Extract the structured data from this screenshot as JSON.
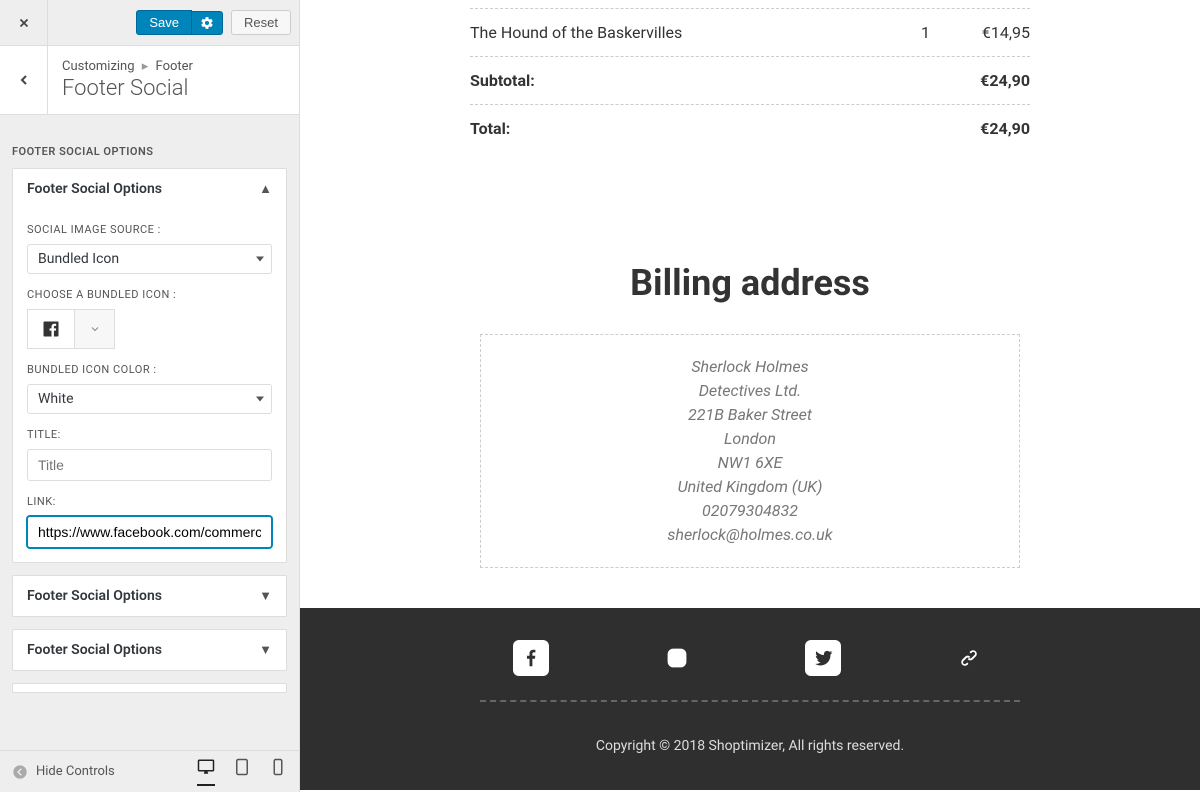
{
  "top": {
    "save": "Save",
    "reset": "Reset"
  },
  "breadcrumb": {
    "root": "Customizing",
    "parent": "Footer",
    "title": "Footer Social"
  },
  "section_heading": "FOOTER SOCIAL OPTIONS",
  "accordion_title": "Footer Social Options",
  "fields": {
    "source_label": "SOCIAL IMAGE SOURCE :",
    "source_value": "Bundled Icon",
    "bundled_label": "CHOOSE A BUNDLED ICON :",
    "color_label": "BUNDLED ICON COLOR :",
    "color_value": "White",
    "title_label": "TITLE:",
    "title_placeholder": "Title",
    "title_value": "",
    "link_label": "LINK:",
    "link_value": "https://www.facebook.com/commerce"
  },
  "collapsed1": "Footer Social Options",
  "collapsed2": "Footer Social Options",
  "bottom": {
    "hide": "Hide Controls"
  },
  "order": {
    "rows": [
      {
        "name": "The Hound of the Baskervilles",
        "qty": "1",
        "price": "€14,95"
      }
    ],
    "subtotal_label": "Subtotal:",
    "subtotal_value": "€24,90",
    "total_label": "Total:",
    "total_value": "€24,90"
  },
  "billing": {
    "heading": "Billing address",
    "lines": [
      "Sherlock Holmes",
      "Detectives Ltd.",
      "221B Baker Street",
      "London",
      "NW1 6XE",
      "United Kingdom (UK)",
      "02079304832",
      "sherlock@holmes.co.uk"
    ]
  },
  "footer_copy": "Copyright © 2018 Shoptimizer, All rights reserved."
}
